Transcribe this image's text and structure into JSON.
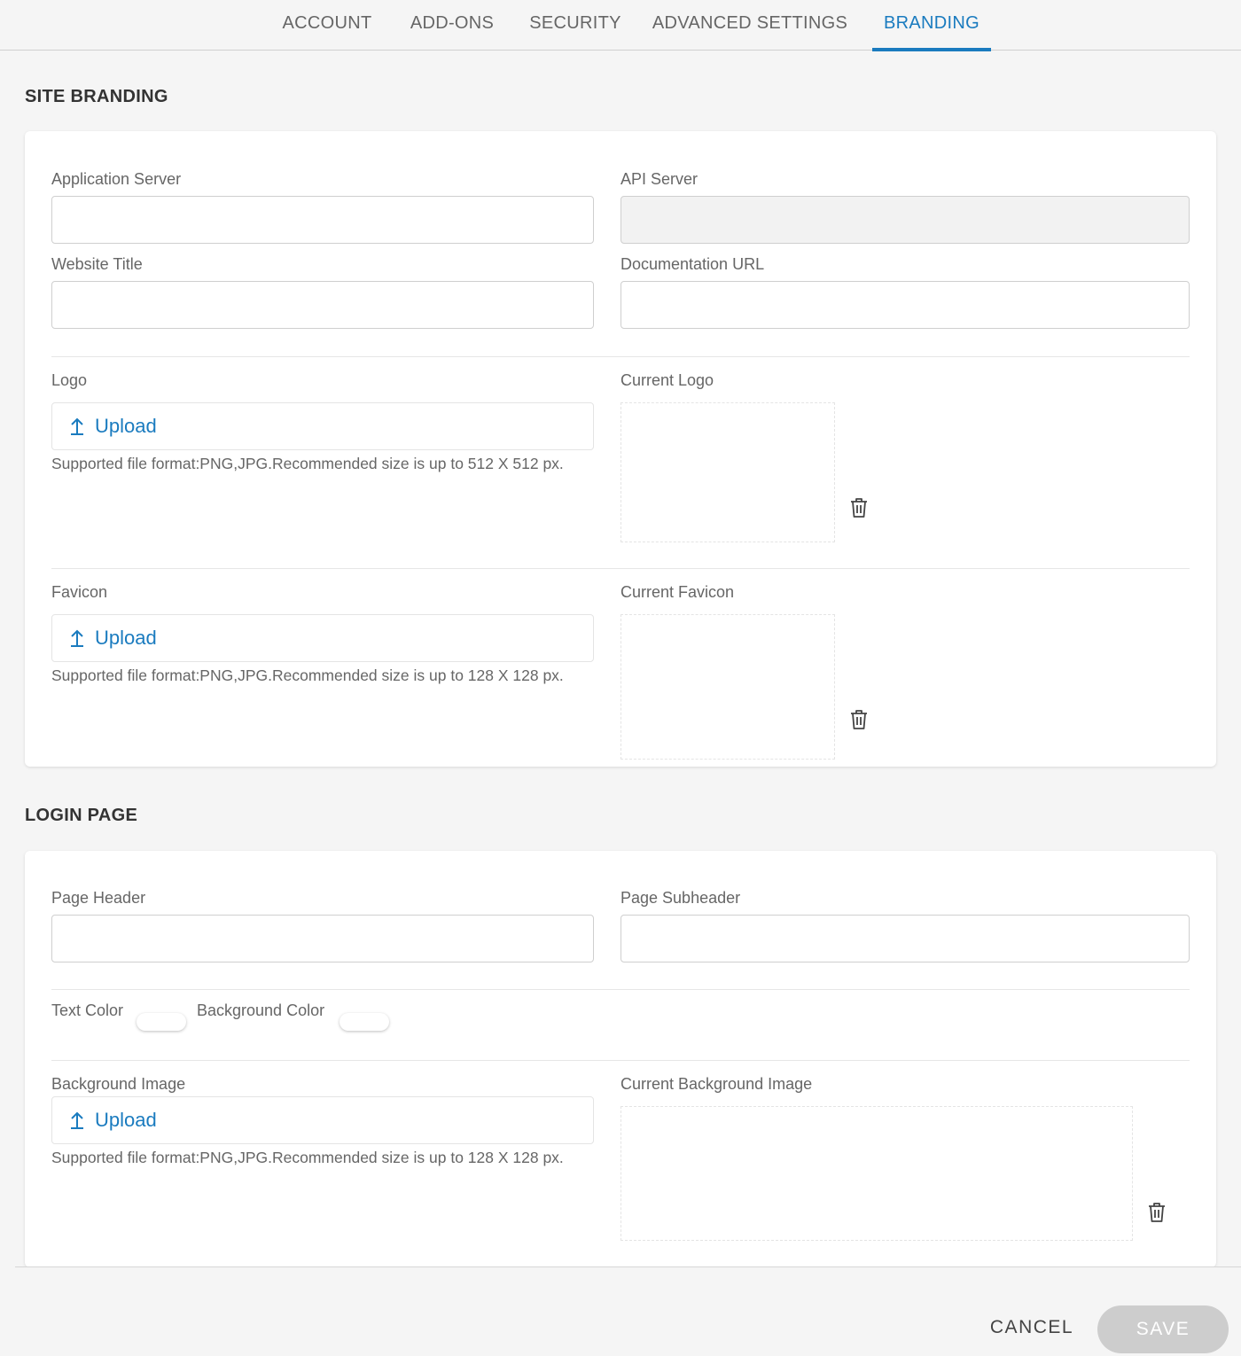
{
  "tabs": [
    {
      "label": "ACCOUNT"
    },
    {
      "label": "ADD-ONS"
    },
    {
      "label": "SECURITY"
    },
    {
      "label": "ADVANCED SETTINGS"
    },
    {
      "label": "BRANDING",
      "active": true
    }
  ],
  "site_branding": {
    "title": "SITE BRANDING",
    "application_server": {
      "label": "Application Server",
      "value": ""
    },
    "api_server": {
      "label": "API Server",
      "value": "",
      "disabled": true
    },
    "website_title": {
      "label": "Website Title",
      "value": ""
    },
    "documentation_url": {
      "label": "Documentation URL",
      "value": ""
    },
    "logo": {
      "label": "Logo",
      "upload_label": "Upload",
      "hint": "Supported file format:PNG,JPG.Recommended size is up to 512 X 512 px.",
      "current_label": "Current Logo"
    },
    "favicon": {
      "label": "Favicon",
      "upload_label": "Upload",
      "hint": "Supported file format:PNG,JPG.Recommended size is up to 128 X 128 px.",
      "current_label": "Current Favicon"
    }
  },
  "login_page": {
    "title": "LOGIN PAGE",
    "page_header": {
      "label": "Page Header",
      "value": ""
    },
    "page_subheader": {
      "label": "Page Subheader",
      "value": ""
    },
    "text_color": {
      "label": "Text Color",
      "value": "#ffffff"
    },
    "background_color": {
      "label": "Background Color",
      "value": "#ffffff"
    },
    "background_image": {
      "label": "Background Image",
      "upload_label": "Upload",
      "hint": "Supported file format:PNG,JPG.Recommended size is up to 128 X 128 px.",
      "current_label": "Current Background Image"
    }
  },
  "footer": {
    "cancel_label": "CANCEL",
    "save_label": "SAVE"
  },
  "colors": {
    "accent": "#1a7bbf",
    "save_disabled": "#cdcdcd"
  }
}
